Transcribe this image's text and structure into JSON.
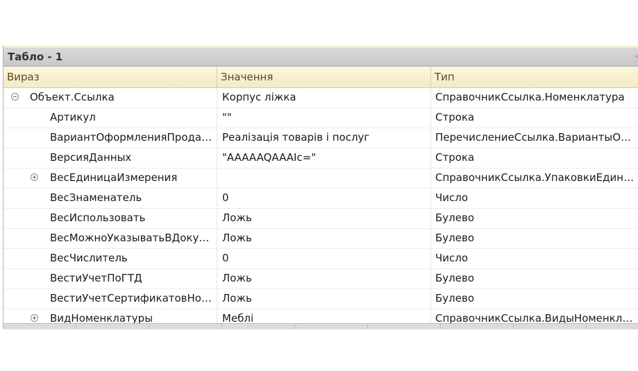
{
  "window": {
    "title": "Табло - 1"
  },
  "columns": [
    "Вираз",
    "Значення",
    "Тип"
  ],
  "rows": [
    {
      "expr": "Объект.Ссылка",
      "value": "Корпус ліжка",
      "type": "СправочникСсылка.Номенклатура",
      "level": 0,
      "toggle": "collapse"
    },
    {
      "expr": "Артикул",
      "value": "\"\"",
      "type": "Строка",
      "level": 1,
      "toggle": ""
    },
    {
      "expr": "ВариантОформленияПродажи",
      "value": "Реалізація товарів і послуг",
      "type": "ПеречислениеСсылка.ВариантыОформленияПродажи",
      "level": 1,
      "toggle": ""
    },
    {
      "expr": "ВерсияДанных",
      "value": "\"AAAAAQAAAIc=\"",
      "type": "Строка",
      "level": 1,
      "toggle": ""
    },
    {
      "expr": "ВесЕдиницаИзмерения",
      "value": "",
      "type": "СправочникСсылка.УпаковкиЕдиницыИзмерения",
      "level": 1,
      "toggle": "expand"
    },
    {
      "expr": "ВесЗнаменатель",
      "value": "0",
      "type": "Число",
      "level": 1,
      "toggle": ""
    },
    {
      "expr": "ВесИспользовать",
      "value": "Ложь",
      "type": "Булево",
      "level": 1,
      "toggle": ""
    },
    {
      "expr": "ВесМожноУказыватьВДокументах",
      "value": "Ложь",
      "type": "Булево",
      "level": 1,
      "toggle": ""
    },
    {
      "expr": "ВесЧислитель",
      "value": "0",
      "type": "Число",
      "level": 1,
      "toggle": ""
    },
    {
      "expr": "ВестиУчетПоГТД",
      "value": "Ложь",
      "type": "Булево",
      "level": 1,
      "toggle": ""
    },
    {
      "expr": "ВестиУчетСертификатовНоменклатуры",
      "value": "Ложь",
      "type": "Булево",
      "level": 1,
      "toggle": ""
    },
    {
      "expr": "ВидНоменклатуры",
      "value": "Меблі",
      "type": "СправочникСсылка.ВидыНоменклатуры",
      "level": 1,
      "toggle": "expand"
    }
  ]
}
